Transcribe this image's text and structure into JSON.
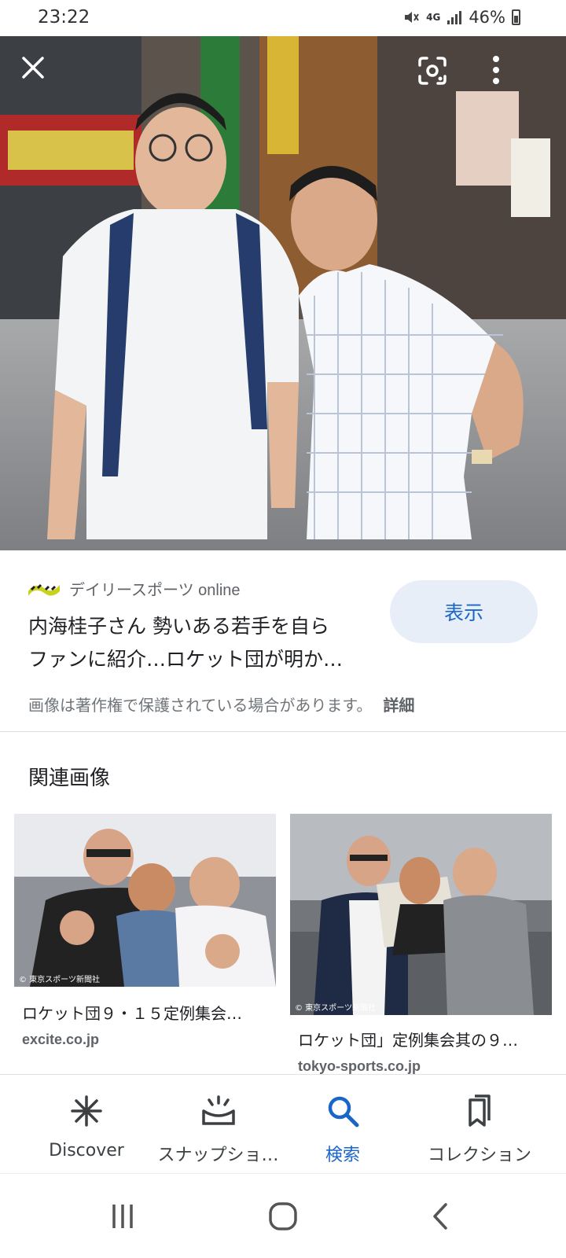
{
  "status_bar": {
    "time": "23:22",
    "network": "4G",
    "battery": "46%"
  },
  "result": {
    "source_name": "デイリースポーツ online",
    "title_line1": "内海桂子さん 勢いある若手を自ら",
    "title_line2": "ファンに紹介…ロケット団が明か…",
    "view_button": "表示",
    "copyright_notice": "画像は著作権で保護されている場合があります。",
    "details_link": "詳細"
  },
  "related": {
    "heading": "関連画像",
    "items": [
      {
        "title": "ロケット団９・１５定例集会…",
        "site": "excite.co.jp",
        "watermark": "© 東京スポーツ新聞社"
      },
      {
        "title": "ロケット団」定例集会其の９…",
        "site": "tokyo-sports.co.jp",
        "watermark": "© 東京スポーツ新聞社"
      }
    ]
  },
  "bottom_nav": {
    "items": [
      {
        "label": "Discover",
        "icon": "asterisk-icon",
        "active": false
      },
      {
        "label": "スナップショ…",
        "icon": "snapshot-icon",
        "active": false
      },
      {
        "label": "検索",
        "icon": "search-icon",
        "active": true
      },
      {
        "label": "コレクション",
        "icon": "bookmarks-icon",
        "active": false
      }
    ]
  },
  "colors": {
    "accent": "#1a66c8",
    "button_bg": "#e8eef8",
    "text_primary": "#202124",
    "text_secondary": "#5f6368"
  }
}
